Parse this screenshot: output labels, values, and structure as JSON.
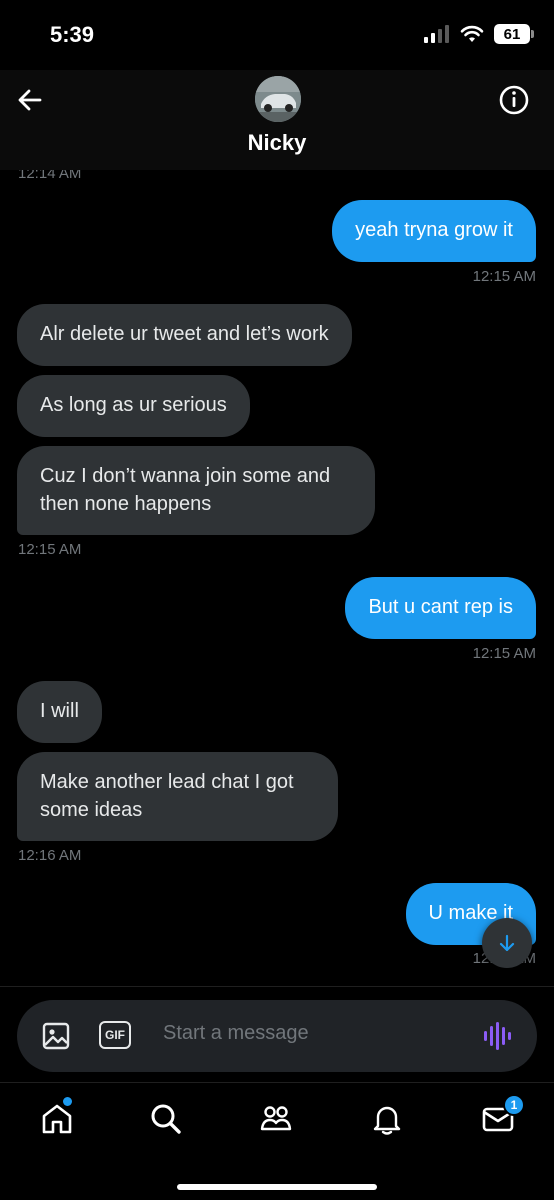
{
  "status_bar": {
    "time": "5:39",
    "battery": "61"
  },
  "header": {
    "contact_name": "Nicky"
  },
  "messages": [
    {
      "text": "12:14 AM"
    },
    {
      "text": "yeah tryna grow it"
    },
    {
      "text": "12:15 AM"
    },
    {
      "text": "Alr delete ur tweet and let’s work"
    },
    {
      "text": "As long as ur serious"
    },
    {
      "text": "Cuz I don’t wanna join some and then none happens"
    },
    {
      "text": "12:15 AM"
    },
    {
      "text": "But u cant rep is"
    },
    {
      "text": "12:15 AM"
    },
    {
      "text": "I will"
    },
    {
      "text": "Make another lead chat I got some ideas"
    },
    {
      "text": "12:16 AM"
    },
    {
      "text": "U make it"
    },
    {
      "text": "12:16 AM"
    }
  ],
  "composer": {
    "placeholder": "Start a message",
    "gif_label": "GIF"
  },
  "tabbar": {
    "messages_badge": "1"
  },
  "colors": {
    "accent": "#1d9bf0",
    "incoming_bubble": "#2f3336",
    "voice_accent": "#8b5cf6"
  }
}
